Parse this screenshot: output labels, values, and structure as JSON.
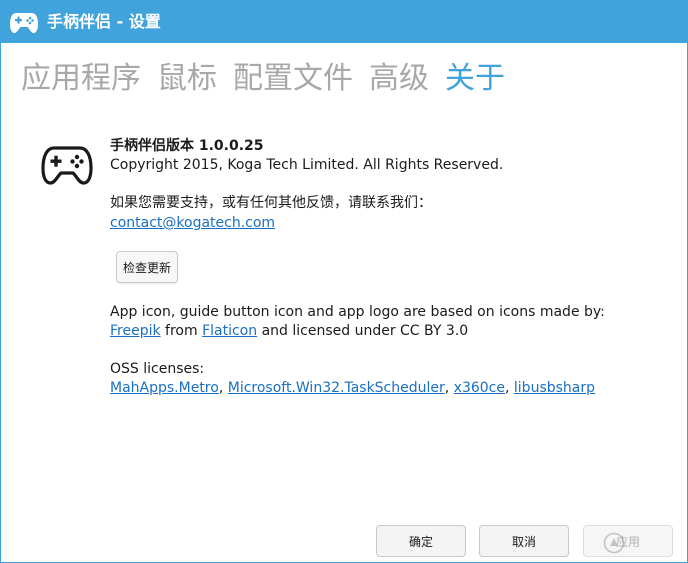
{
  "window": {
    "title": "手柄伴侣 - 设置"
  },
  "tabs": [
    {
      "label": "应用程序",
      "active": false
    },
    {
      "label": "鼠标",
      "active": false
    },
    {
      "label": "配置文件",
      "active": false
    },
    {
      "label": "高级",
      "active": false
    },
    {
      "label": "关于",
      "active": true
    }
  ],
  "about": {
    "version_line": "手柄伴侣版本 1.0.0.25",
    "copyright": "Copyright 2015, Koga Tech Limited. All Rights Reserved.",
    "support_text": "如果您需要支持，或有任何其他反馈，请联系我们：",
    "contact_email": "contact@kogatech.com",
    "check_update_label": "检查更新",
    "icons_credit_text": "App icon, guide button icon and app logo are based on icons made by:",
    "credit_link_freepik": "Freepik",
    "credit_from": " from ",
    "credit_link_flaticon": "Flaticon",
    "credit_license": " and licensed under CC BY 3.0",
    "oss_title": "OSS licenses:",
    "oss_links": [
      "MahApps.Metro",
      "Microsoft.Win32.TaskScheduler",
      "x360ce",
      "libusbsharp"
    ],
    "oss_separator": ", "
  },
  "footer": {
    "ok_label": "确定",
    "cancel_label": "取消",
    "apply_label": "应用"
  },
  "icons": {
    "title_icon": "gamepad-icon",
    "app_logo": "gamepad-icon"
  },
  "colors": {
    "accent": "#41a3dc",
    "link": "#1a6fc4",
    "inactive_tab": "#a8a8a8"
  }
}
